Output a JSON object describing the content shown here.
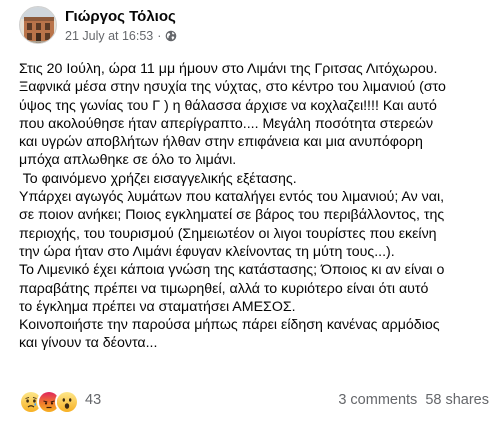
{
  "post": {
    "author": "Γιώργος Τόλιος",
    "timestamp": "21 July at 16:53",
    "separator": "·",
    "audience_icon": "globe-icon",
    "body_lines": [
      "Στις 20 Ιούλη, ώρα 11 μμ ήμουν στο Λιμάνι της Γριτσας Λιτόχωρου.",
      "Ξαφνικά μέσα στην ησυχία της νύχτας, στο κέντρο του λιμανιού (στο",
      "ύψος της γωνίας του Γ )  η θάλασσα άρχισε να κοχλαζει!!!! Και αυτό",
      "που ακολούθησε ήταν απερίγραπτο.... Μεγάλη ποσότητα στερεών",
      "και υγρών αποβλήτων ήλθαν στην επιφάνεια και μια ανυπόφορη",
      "μπόχα απλωθηκε σε όλο το λιμάνι.",
      " Το φαινόμενο χρήζει εισαγγελικής εξέτασης.",
      "Υπάρχει αγωγός λυμάτων που καταλήγει εντός του λιμανιού; Αν ναι,",
      "σε ποιον ανήκει; Ποιος εγκληματεί σε βάρος του περιβάλλοντος, της",
      "περιοχής, του τουρισμού (Σημειωτέον οι λιγοι τουρίστες που εκείνη",
      "την ώρα ήταν στο Λιμάνι έφυγαν κλείνοντας τη μύτη τους...).",
      "Το Λιμενικό έχει κάποια γνώση της κατάστασης; Όποιος κι αν είναι ο",
      "παραβάτης πρέπει να τιμωρηθεί, αλλά το κυριότερο είναι ότι αυτό",
      "το έγκλημα πρέπει να σταματήσει ΑΜΕΣΟΣ.",
      "Κοινοποιήστε την παρούσα μήπως πάρει είδηση κανένας αρμόδιος",
      "και γίνουν τα δέοντα..."
    ]
  },
  "footer": {
    "reactions": [
      {
        "name": "sad-reaction-icon",
        "color": "#f7b125"
      },
      {
        "name": "angry-reaction-icon",
        "color": "#e9710f"
      },
      {
        "name": "wow-reaction-icon",
        "color": "#f7b125"
      }
    ],
    "reaction_count": "43",
    "comments": "3 comments",
    "shares": "58 shares"
  }
}
